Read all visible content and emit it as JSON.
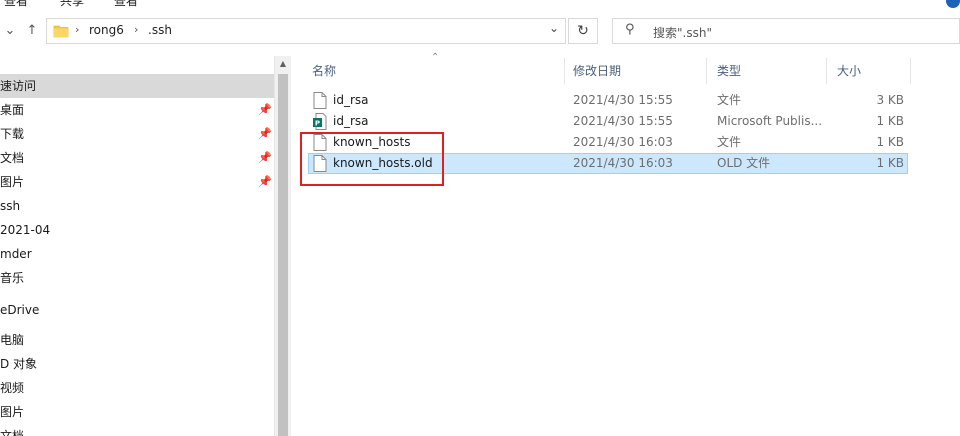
{
  "ribbon": {
    "fragments": [
      "查看",
      "共享",
      "查看"
    ]
  },
  "address": {
    "crumbs": [
      "rong6",
      ".ssh"
    ]
  },
  "search": {
    "placeholder": "搜索\".ssh\""
  },
  "nav": {
    "items": [
      {
        "label": "速访问",
        "pinned": false,
        "selected": true
      },
      {
        "label": "桌面",
        "pinned": true
      },
      {
        "label": "下载",
        "pinned": true
      },
      {
        "label": "文档",
        "pinned": true
      },
      {
        "label": "图片",
        "pinned": true
      },
      {
        "label": "ssh",
        "pinned": false
      },
      {
        "label": "2021-04",
        "pinned": false
      },
      {
        "label": "mder",
        "pinned": false
      },
      {
        "label": "音乐",
        "pinned": false
      },
      {
        "label": "eDrive",
        "pinned": false
      },
      {
        "label": "电脑",
        "pinned": false
      },
      {
        "label": "D 对象",
        "pinned": false
      },
      {
        "label": "视频",
        "pinned": false
      },
      {
        "label": "图片",
        "pinned": false
      },
      {
        "label": "文档",
        "pinned": false
      }
    ]
  },
  "columns": {
    "name": "名称",
    "modified": "修改日期",
    "type": "类型",
    "size": "大小"
  },
  "files": [
    {
      "name": "id_rsa",
      "modified": "2021/4/30 15:55",
      "type": "文件",
      "size": "3 KB",
      "icon": "generic-file-icon",
      "selected": false
    },
    {
      "name": "id_rsa",
      "modified": "2021/4/30 15:55",
      "type": "Microsoft Publis...",
      "size": "1 KB",
      "icon": "publisher-file-icon",
      "selected": false
    },
    {
      "name": "known_hosts",
      "modified": "2021/4/30 16:03",
      "type": "文件",
      "size": "1 KB",
      "icon": "generic-file-icon",
      "selected": false
    },
    {
      "name": "known_hosts.old",
      "modified": "2021/4/30 16:03",
      "type": "OLD 文件",
      "size": "1 KB",
      "icon": "generic-file-icon",
      "selected": true
    }
  ],
  "colors": {
    "selection_bg": "#cce8ff",
    "selection_border": "#99d1ff",
    "highlight_box": "#e02020",
    "publisher_green": "#077568"
  }
}
